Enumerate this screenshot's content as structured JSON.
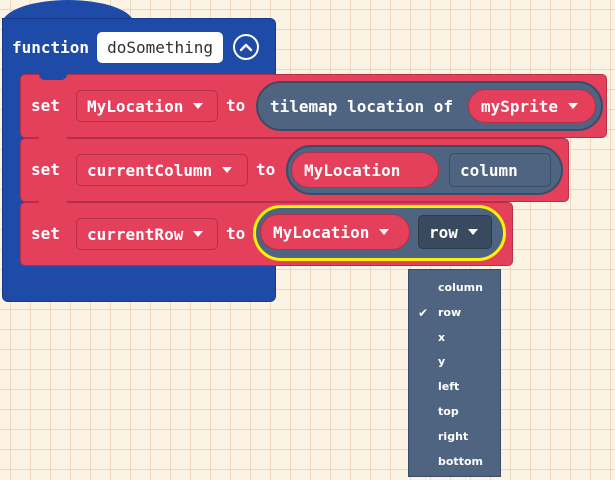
{
  "function_block": {
    "keyword": "function",
    "name": "doSomething",
    "collapse_icon": "chevron-up-circle-icon"
  },
  "set_blocks": [
    {
      "set_label": "set",
      "variable": "MyLocation",
      "to_label": "to",
      "value": {
        "type": "tilemap-location",
        "label": "tilemap location of",
        "sprite": "mySprite"
      }
    },
    {
      "set_label": "set",
      "variable": "currentColumn",
      "to_label": "to",
      "value": {
        "type": "location-property",
        "location": "MyLocation",
        "property": "column"
      }
    },
    {
      "set_label": "set",
      "variable": "currentRow",
      "to_label": "to",
      "value": {
        "type": "location-property",
        "location": "MyLocation",
        "property": "row"
      }
    }
  ],
  "dropdown_menu": {
    "selected": "row",
    "options": [
      {
        "label": "column",
        "checked": false
      },
      {
        "label": "row",
        "checked": true
      },
      {
        "label": "x",
        "checked": false
      },
      {
        "label": "y",
        "checked": false
      },
      {
        "label": "left",
        "checked": false
      },
      {
        "label": "top",
        "checked": false
      },
      {
        "label": "right",
        "checked": false
      },
      {
        "label": "bottom",
        "checked": false
      }
    ],
    "check_icon": "checkmark-icon"
  },
  "colors": {
    "function_block": "#1e4aa8",
    "set_block": "#e43f5b",
    "reporter": "#4e6480",
    "highlight": "#fff200",
    "background": "#fbf3e3"
  }
}
